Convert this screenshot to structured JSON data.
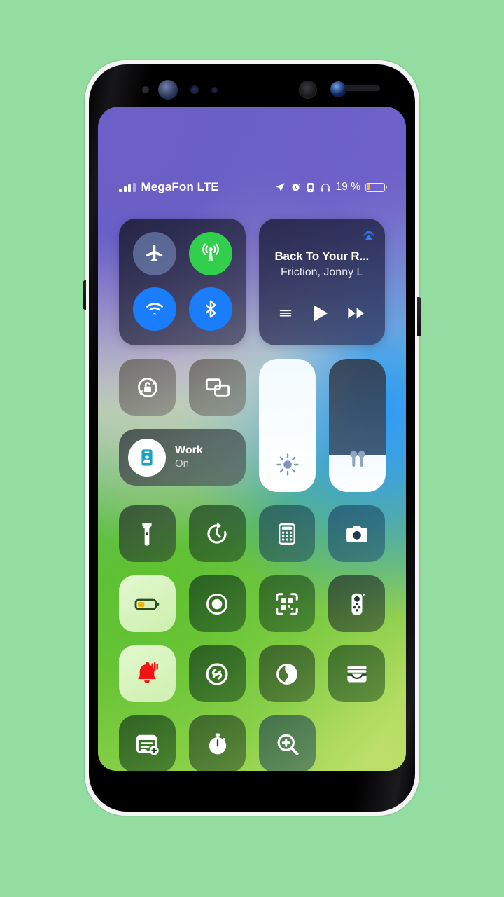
{
  "wallpaper": {
    "top_color": "#6a5ec5",
    "mid_color": "#3fa6d8",
    "bottom_color": "#a9d85c",
    "page_bg": "#94dda0"
  },
  "status_bar": {
    "carrier": "MegaFon LTE",
    "signal_bars_filled": 3,
    "signal_bars_total": 4,
    "battery_percent_label": "19 %",
    "battery_level": 19,
    "battery_color": "#f6bd17",
    "icons": [
      "location-arrow-icon",
      "alarm-clock-icon",
      "portrait-orientation-lock-icon",
      "headphones-icon"
    ]
  },
  "connectivity": {
    "airplane": {
      "name": "Airplane Mode",
      "state": "off",
      "color": "#768cbe"
    },
    "cellular": {
      "name": "Cellular Data",
      "state": "on",
      "color": "#31cf4c"
    },
    "wifi": {
      "name": "Wi-Fi",
      "state": "on",
      "color": "#1a7dfb"
    },
    "bluetooth": {
      "name": "Bluetooth",
      "state": "on",
      "color": "#1a7dfb"
    }
  },
  "music": {
    "title": "Back To Your R...",
    "artist": "Friction, Jonny L",
    "airplay_icon": "airplay-audio-icon",
    "controls": [
      "queue-list-icon",
      "play-icon",
      "fast-forward-icon"
    ]
  },
  "toggles": {
    "rotation_lock": {
      "label": "Rotation Lock",
      "state": "off"
    },
    "screen_mirroring": {
      "label": "Screen Mirroring",
      "state": "off"
    }
  },
  "focus": {
    "title": "Work",
    "subtitle": "On",
    "icon": "id-card-icon",
    "icon_color": "#1ba3bd"
  },
  "sliders": {
    "brightness": {
      "label": "Brightness",
      "value": 100,
      "icon": "sun-icon"
    },
    "volume": {
      "label": "Volume",
      "value": 28,
      "icon": "airpods-icon"
    }
  },
  "tiles": [
    {
      "name": "flashlight",
      "icon": "flashlight-icon",
      "active": false
    },
    {
      "name": "timer",
      "icon": "timer-icon",
      "active": false
    },
    {
      "name": "calculator",
      "icon": "calculator-icon",
      "active": false
    },
    {
      "name": "camera",
      "icon": "camera-icon",
      "active": false
    },
    {
      "name": "low-power-mode",
      "icon": "battery-low-icon",
      "active": true
    },
    {
      "name": "screen-record",
      "icon": "screen-record-icon",
      "active": false
    },
    {
      "name": "code-scanner",
      "icon": "qr-scanner-icon",
      "active": false
    },
    {
      "name": "apple-tv-remote",
      "icon": "remote-control-icon",
      "active": false
    },
    {
      "name": "ringer-alarm",
      "icon": "bell-ringing-icon",
      "active": true
    },
    {
      "name": "shazam",
      "icon": "shazam-icon",
      "active": false
    },
    {
      "name": "dark-mode",
      "icon": "dark-mode-icon",
      "active": false
    },
    {
      "name": "wallet",
      "icon": "wallet-icon",
      "active": false
    },
    {
      "name": "quick-note",
      "icon": "note-add-icon",
      "active": false
    },
    {
      "name": "stopwatch",
      "icon": "stopwatch-icon",
      "active": false
    },
    {
      "name": "magnifier",
      "icon": "magnifier-icon",
      "active": false
    }
  ]
}
